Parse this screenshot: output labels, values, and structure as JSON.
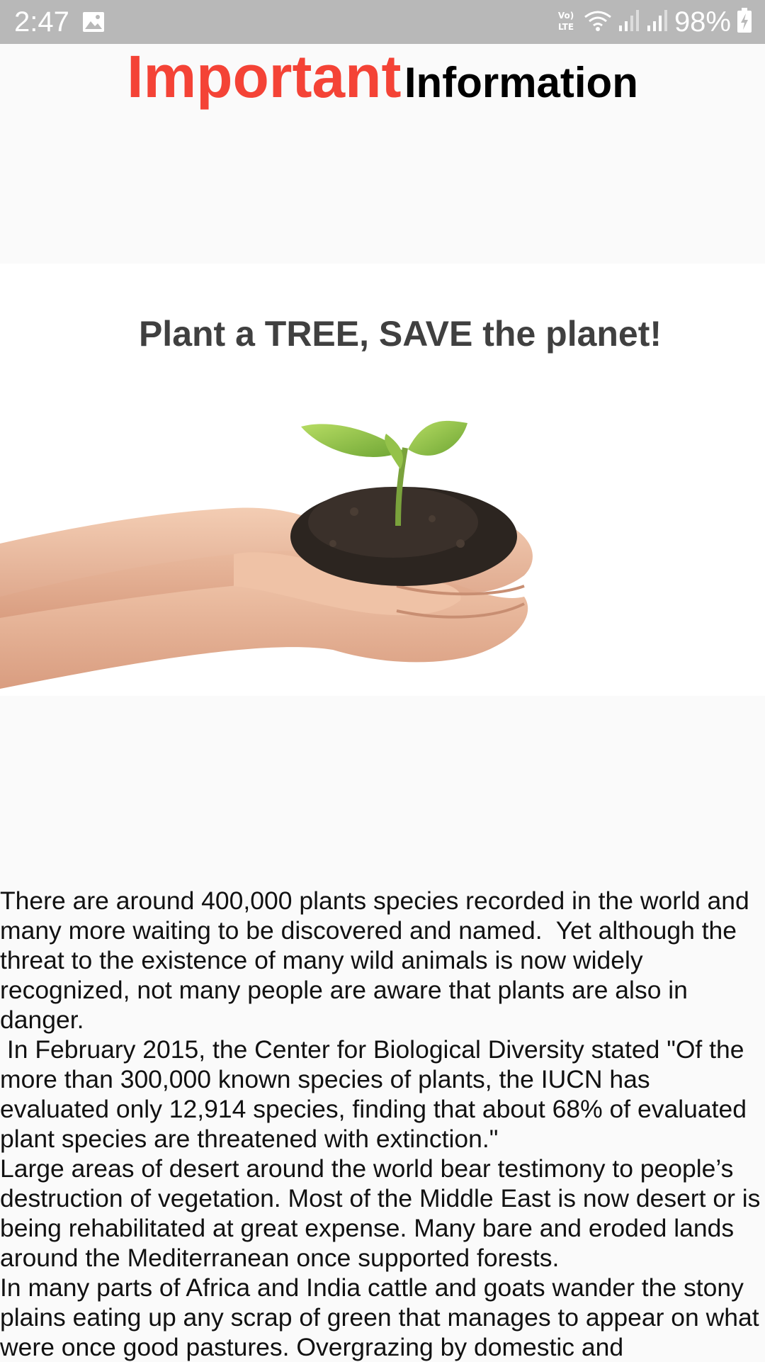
{
  "status_bar": {
    "time": "2:47",
    "network_label": "VoLTE",
    "battery_percent": "98%",
    "icons": [
      "gallery-icon",
      "volte-icon",
      "wifi-icon",
      "signal-icon",
      "signal-icon",
      "battery-charging-icon"
    ]
  },
  "header": {
    "title_highlight": "Important",
    "title_rest": "Information",
    "highlight_color": "#f44336"
  },
  "hero": {
    "caption": "Plant a TREE, SAVE the planet!",
    "image_description_icon": "seedling-in-hands-image"
  },
  "article": {
    "body": "There are around 400,000 plants species recorded in the world and many more waiting to be discovered and named.  Yet although the threat to the existence of many wild animals is now widely recognized, not many people are aware that plants are also in danger.\n In February 2015, the Center for Biological Diversity stated \"Of the more than 300,000 known species of plants, the IUCN has evaluated only 12,914 species, finding that about 68% of evaluated plant species are threatened with extinction.\"\nLarge areas of desert around the world bear testimony to people’s destruction of vegetation. Most of the Middle East is now desert or is being rehabilitated at great expense. Many bare and eroded lands around the Mediterranean once supported forests.\nIn many parts of Africa and India cattle and goats wander the stony plains eating up any scrap of green that manages to appear on what were once good pastures. Overgrazing by domestic and"
  }
}
